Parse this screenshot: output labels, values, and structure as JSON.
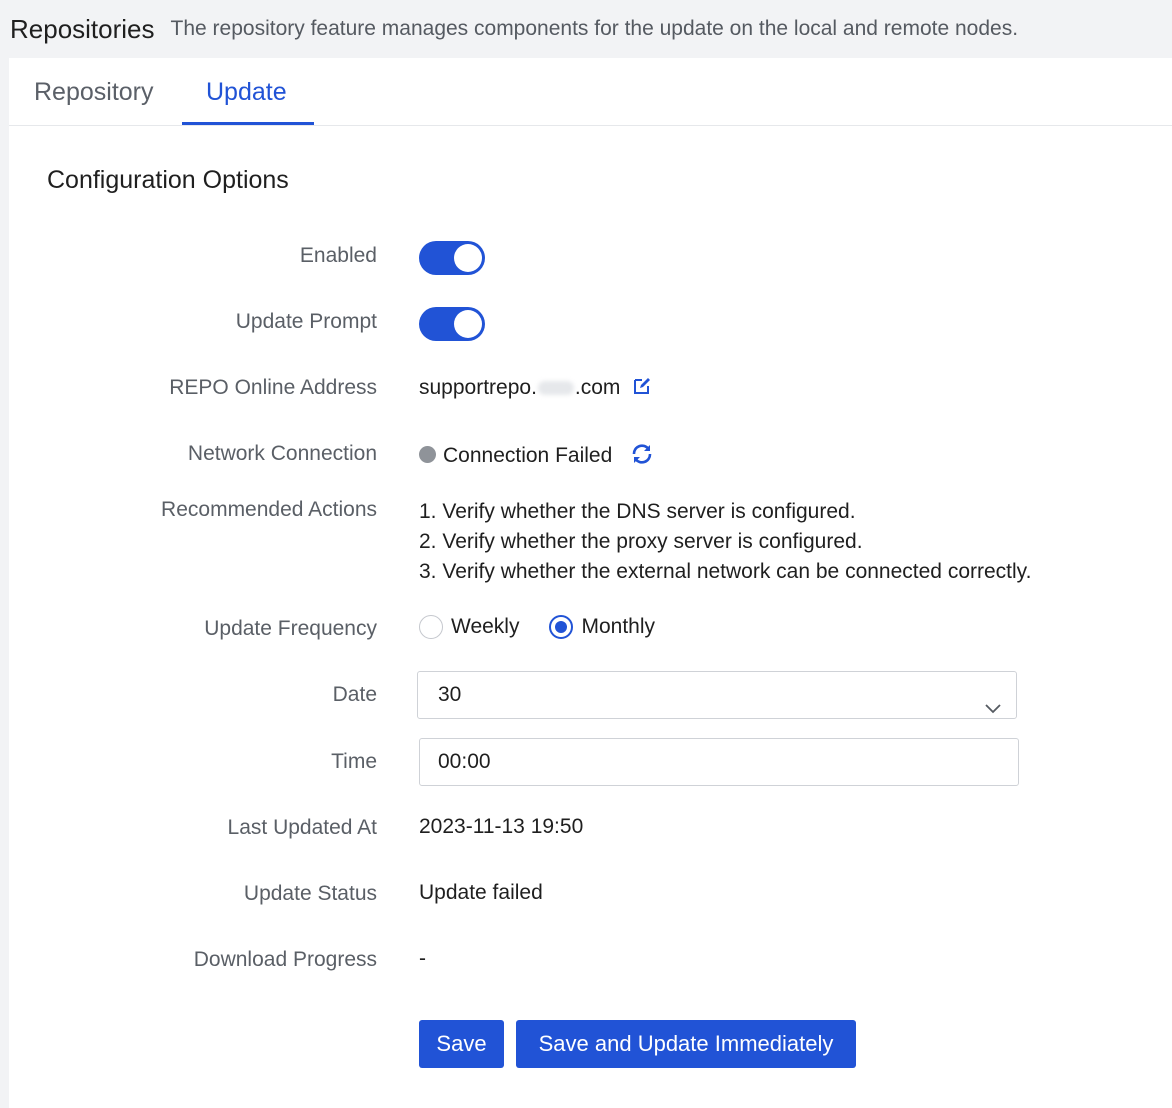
{
  "header": {
    "title": "Repositories",
    "description": "The repository feature manages components for the update on the local and remote nodes."
  },
  "tabs": [
    {
      "label": "Repository",
      "active": false
    },
    {
      "label": "Update",
      "active": true
    }
  ],
  "section": {
    "title": "Configuration Options"
  },
  "fields": {
    "enabled": {
      "label": "Enabled",
      "on": true
    },
    "update_prompt": {
      "label": "Update Prompt",
      "on": true
    },
    "repo_address": {
      "label": "REPO Online Address",
      "value_prefix": "supportrepo.",
      "value_suffix": ".com"
    },
    "network": {
      "label": "Network Connection",
      "status": "Connection Failed"
    },
    "recommended": {
      "label": "Recommended Actions",
      "items": [
        "1. Verify whether the DNS server is configured.",
        "2. Verify whether the proxy server is configured.",
        "3. Verify whether the external network can be connected correctly."
      ]
    },
    "frequency": {
      "label": "Update Frequency",
      "options": [
        {
          "label": "Weekly",
          "checked": false
        },
        {
          "label": "Monthly",
          "checked": true
        }
      ]
    },
    "date": {
      "label": "Date",
      "value": "30"
    },
    "time": {
      "label": "Time",
      "value": "00:00"
    },
    "last_updated": {
      "label": "Last Updated At",
      "value": "2023-11-13 19:50"
    },
    "update_status": {
      "label": "Update Status",
      "value": "Update failed"
    },
    "download_progress": {
      "label": "Download Progress",
      "value": "-"
    }
  },
  "buttons": {
    "save": "Save",
    "save_update": "Save and Update Immediately"
  },
  "colors": {
    "accent": "#2153d6",
    "status_failed_dot": "#8f9399"
  },
  "icons": {
    "edit": "edit-icon",
    "refresh": "refresh-icon",
    "dropdown": "chevron-down-icon"
  }
}
